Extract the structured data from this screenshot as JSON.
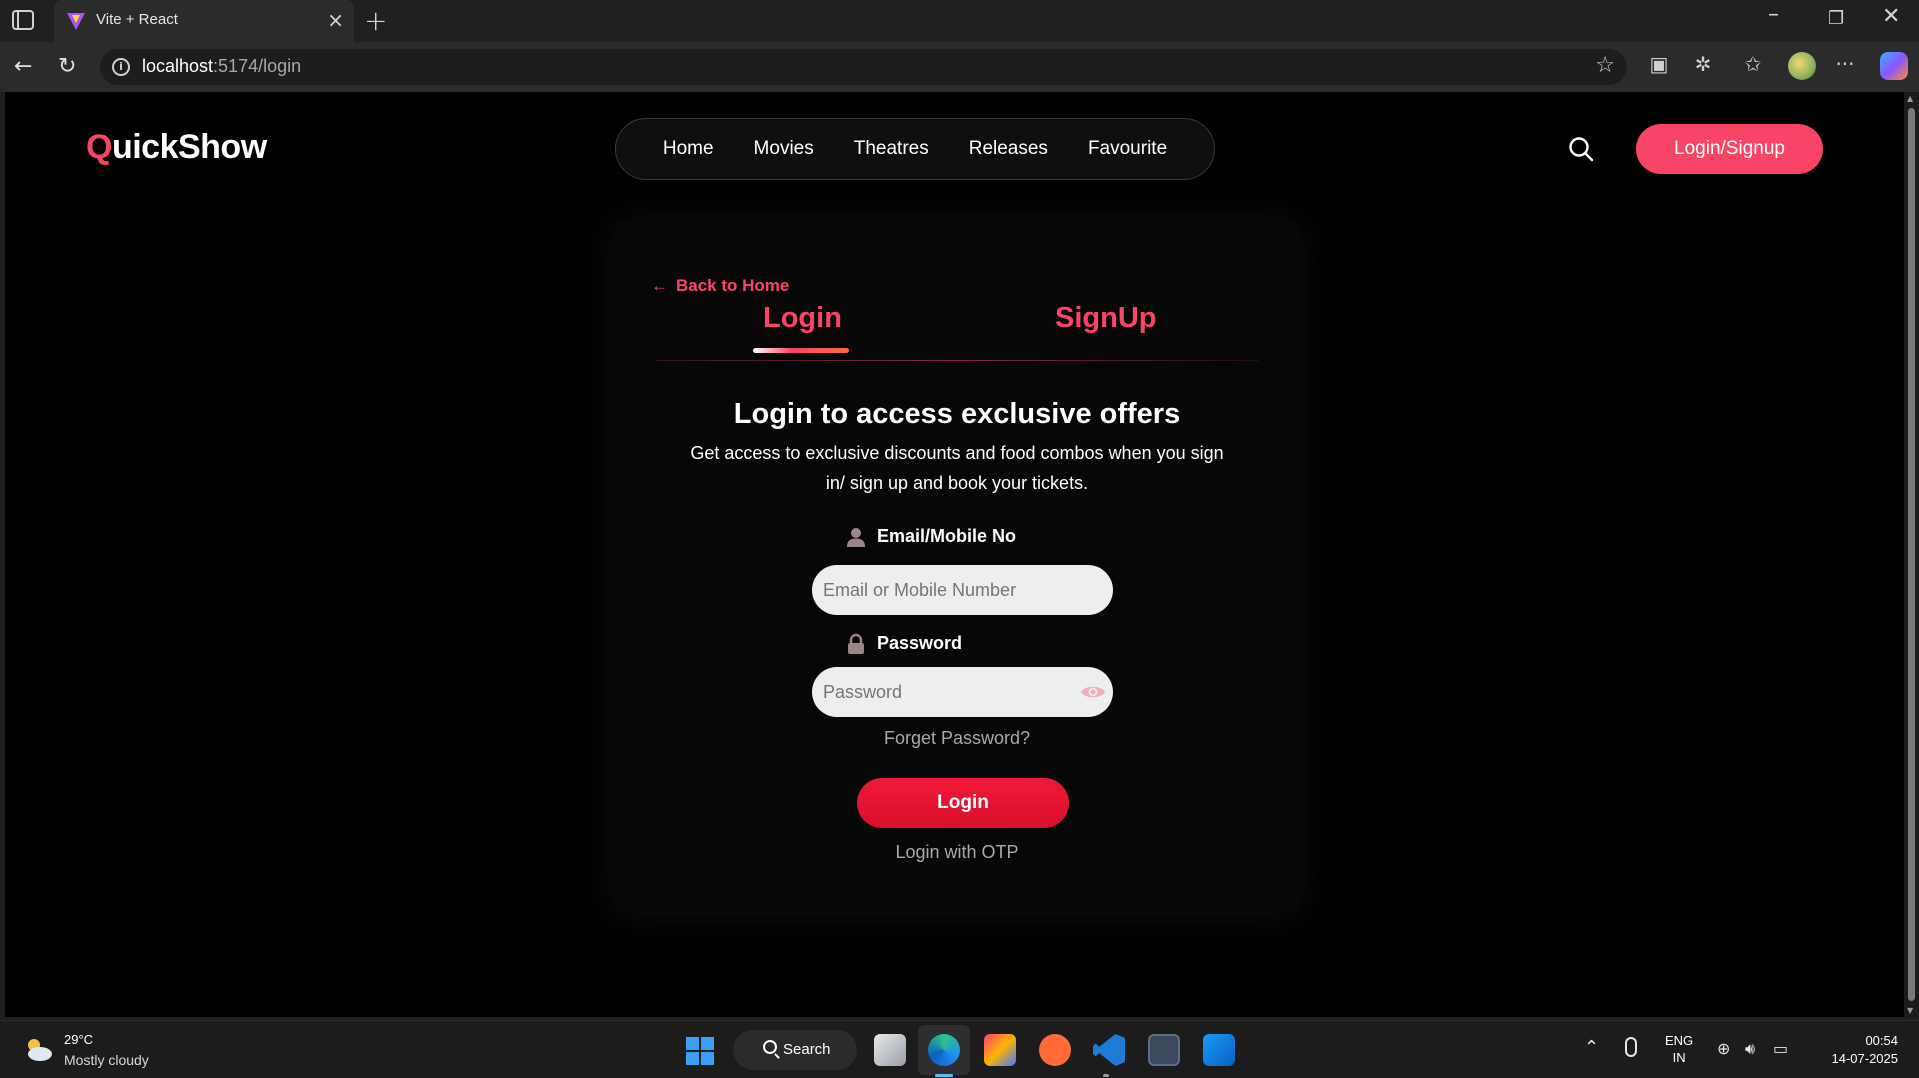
{
  "browser": {
    "tab_title": "Vite + React",
    "url_host": "localhost",
    "url_path": ":5174/login"
  },
  "app": {
    "logo_first": "Q",
    "logo_rest": "uickShow",
    "brand_color": "#f84565",
    "nav": [
      "Home",
      "Movies",
      "Theatres",
      "Releases",
      "Favourite"
    ],
    "login_signup_label": "Login/Signup"
  },
  "auth": {
    "back_label": "Back to Home",
    "tab_login": "Login",
    "tab_signup": "SignUp",
    "headline": "Login to access exclusive offers",
    "subtext": "Get access to exclusive discounts and food combos when you sign in/ sign up and book your tickets.",
    "email_label": "Email/Mobile No",
    "email_placeholder": "Email or Mobile Number",
    "password_label": "Password",
    "password_placeholder": "Password",
    "forget_label": "Forget Password?",
    "login_button": "Login",
    "otp_label": "Login with OTP"
  },
  "taskbar": {
    "weather_temp": "29°C",
    "weather_desc": "Mostly cloudy",
    "search_label": "Search",
    "lang_1": "ENG",
    "lang_2": "IN",
    "time": "00:54",
    "date": "14-07-2025"
  }
}
